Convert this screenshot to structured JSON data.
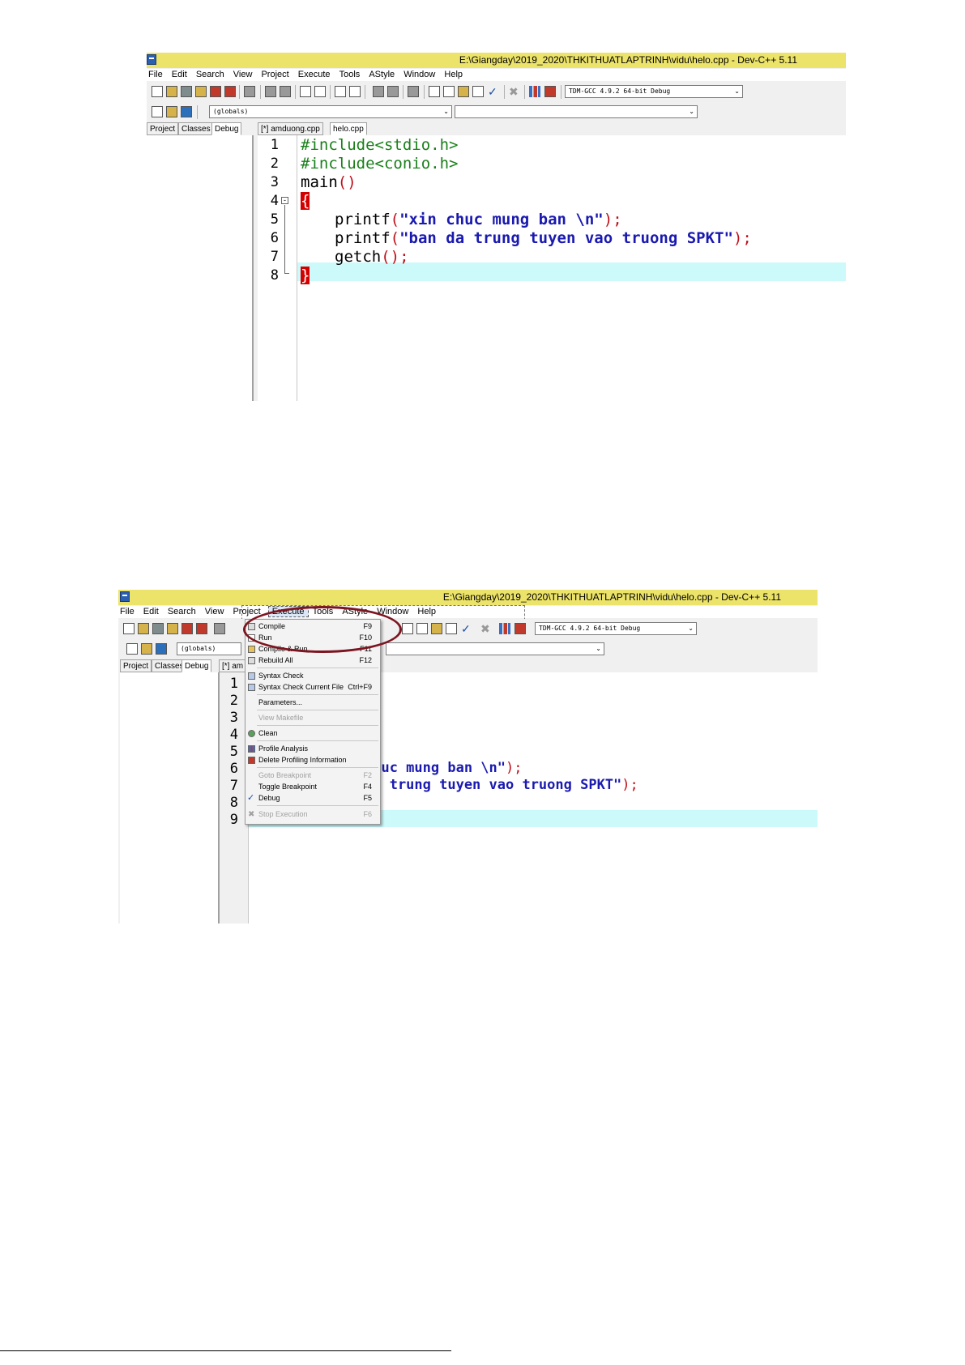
{
  "screenshot1": {
    "title": "E:\\Giangday\\2019_2020\\THKITHUATLAPTRINH\\vidu\\helo.cpp - Dev-C++ 5.11",
    "menu": [
      "File",
      "Edit",
      "Search",
      "View",
      "Project",
      "Execute",
      "Tools",
      "AStyle",
      "Window",
      "Help"
    ],
    "compiler": "TDM-GCC 4.9.2 64-bit Debug",
    "scope": "(globals)",
    "panel_tabs": [
      "Project",
      "Classes",
      "Debug"
    ],
    "file_tabs": [
      "[*] amduong.cpp",
      "helo.cpp"
    ],
    "line_numbers": [
      "1",
      "2",
      "3",
      "4",
      "5",
      "6",
      "7",
      "8"
    ],
    "code": {
      "l1": "#include<stdio.h>",
      "l2": "#include<conio.h>",
      "l3_fn": "main",
      "l3_paren": "()",
      "l4_brace": "{",
      "l5_fn": "printf",
      "l5_open": "(",
      "l5_str": "\"xin chuc mung ban \\n\"",
      "l5_close": ");",
      "l6_fn": "printf",
      "l6_open": "(",
      "l6_str": "\"ban da trung tuyen vao truong SPKT\"",
      "l6_close": ");",
      "l7_fn": "getch",
      "l7_paren": "();",
      "l8_brace": "}"
    }
  },
  "screenshot2": {
    "title": "E:\\Giangday\\2019_2020\\THKITHUATLAPTRINH\\vidu\\helo.cpp - Dev-C++ 5.11",
    "menu": [
      "File",
      "Edit",
      "Search",
      "View",
      "Project",
      "Execute",
      "Tools",
      "AStyle",
      "Window",
      "Help"
    ],
    "compiler": "TDM-GCC 4.9.2 64-bit Debug",
    "scope": "(globals)",
    "panel_tabs": [
      "Project",
      "Classes",
      "Debug"
    ],
    "file_tab": "[*] am",
    "line_numbers": [
      "1",
      "2",
      "3",
      "4",
      "5",
      "6",
      "7",
      "8",
      "9"
    ],
    "code": {
      "l6_str": "chuc mung ban \\n\"",
      "l6_close": ");",
      "l7_str": "da trung tuyen vao truong SPKT\"",
      "l7_close": ");"
    },
    "execute_menu": [
      {
        "label": "Compile",
        "key": "F9"
      },
      {
        "label": "Run",
        "key": "F10"
      },
      {
        "label": "Compile & Run",
        "key": "F11"
      },
      {
        "label": "Rebuild All",
        "key": "F12"
      },
      {
        "label": "Syntax Check",
        "key": ""
      },
      {
        "label": "Syntax Check Current File",
        "key": "Ctrl+F9"
      },
      {
        "label": "Parameters...",
        "key": ""
      },
      {
        "label": "View Makefile",
        "key": ""
      },
      {
        "label": "Clean",
        "key": ""
      },
      {
        "label": "Profile Analysis",
        "key": ""
      },
      {
        "label": "Delete Profiling Information",
        "key": ""
      },
      {
        "label": "Goto Breakpoint",
        "key": "F2"
      },
      {
        "label": "Toggle Breakpoint",
        "key": "F4"
      },
      {
        "label": "Debug",
        "key": "F5"
      },
      {
        "label": "Stop Execution",
        "key": "F6"
      }
    ]
  }
}
